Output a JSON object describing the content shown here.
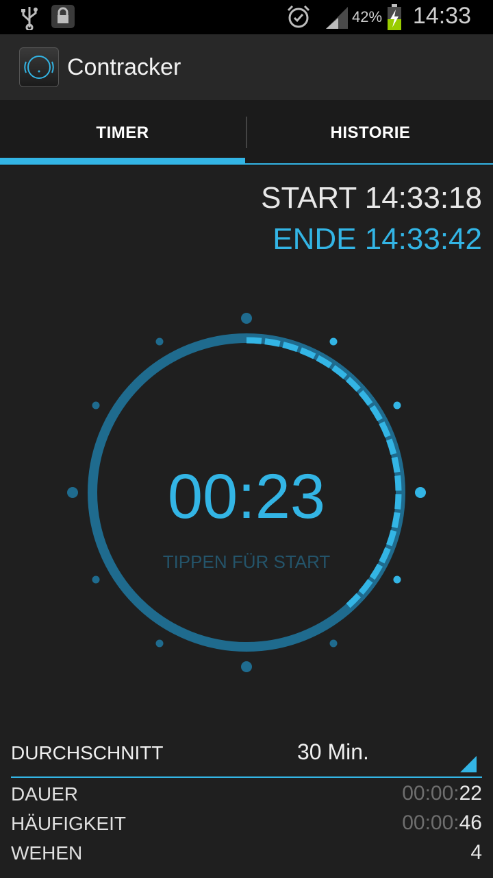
{
  "status_bar": {
    "battery_percent": "42%",
    "time": "14:33",
    "icons": [
      "usb-icon",
      "lock-icon",
      "alarm-icon",
      "signal-icon",
      "battery-charging-icon"
    ]
  },
  "app": {
    "title": "Contracker"
  },
  "tabs": [
    {
      "label": "TIMER",
      "selected": true
    },
    {
      "label": "HISTORIE",
      "selected": false
    }
  ],
  "session": {
    "start": "START 14:33:18",
    "end": "ENDE 14:33:42"
  },
  "timer": {
    "value": "00:23",
    "hint": "TIPPEN FÜR START",
    "progress_seconds": 23,
    "full_circle_seconds": 60
  },
  "stats": {
    "average_label": "DURCHSCHNITT",
    "average_value": "30 Min.",
    "rows": [
      {
        "label": "DAUER",
        "value_dim": "00:00:",
        "value_bright": "22"
      },
      {
        "label": "HÄUFIGKEIT",
        "value_dim": "00:00:",
        "value_bright": "46"
      },
      {
        "label": "WEHEN",
        "value_dim": "",
        "value_bright": "4"
      }
    ]
  },
  "colors": {
    "accent": "#33b5e5",
    "ring": "#1f6b8e",
    "background": "#1f1f1f"
  }
}
